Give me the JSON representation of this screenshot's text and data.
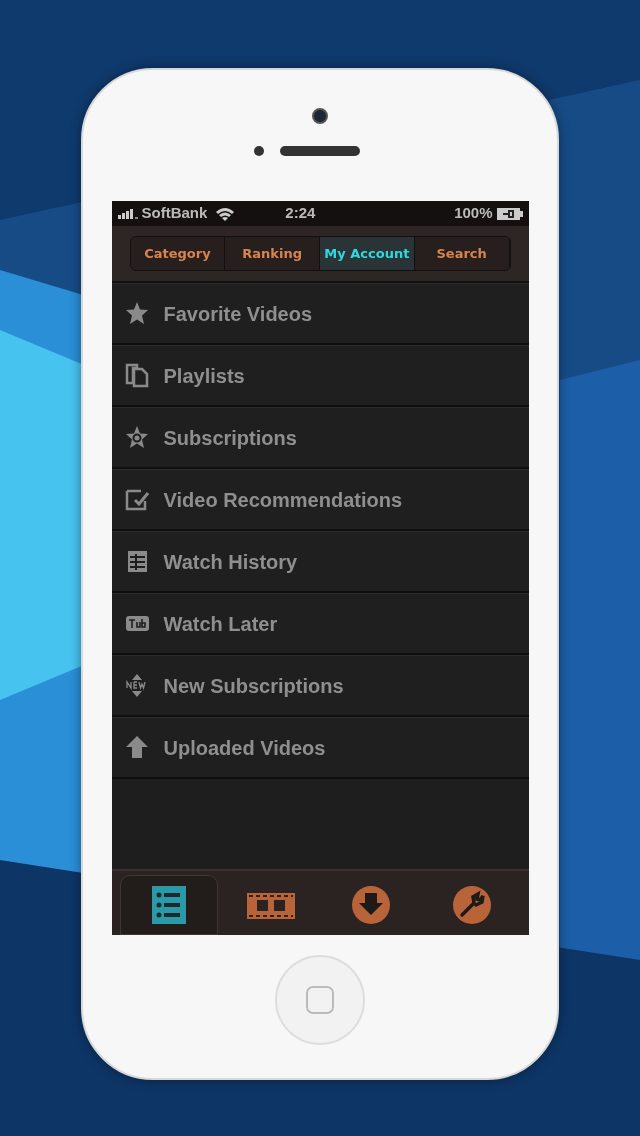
{
  "status_bar": {
    "carrier": "SoftBank",
    "time": "2:24",
    "battery": "100%"
  },
  "tabs": [
    {
      "label": "Category",
      "selected": false
    },
    {
      "label": "Ranking",
      "selected": false
    },
    {
      "label": "My Account",
      "selected": true
    },
    {
      "label": "Search",
      "selected": false
    }
  ],
  "menu": [
    {
      "kind": "star",
      "label": "Favorite Videos"
    },
    {
      "kind": "pages",
      "label": "Playlists"
    },
    {
      "kind": "badge",
      "label": "Subscriptions"
    },
    {
      "kind": "note",
      "label": "Video Recommendations"
    },
    {
      "kind": "grid",
      "label": "Watch History"
    },
    {
      "kind": "tube",
      "label": "Watch Later"
    },
    {
      "kind": "new",
      "label": "New Subscriptions"
    },
    {
      "kind": "up",
      "label": "Uploaded Videos"
    }
  ],
  "tab_bar": [
    {
      "kind": "list",
      "selected": true
    },
    {
      "kind": "film",
      "selected": false
    },
    {
      "kind": "download",
      "selected": false
    },
    {
      "kind": "wrench",
      "selected": false
    }
  ]
}
